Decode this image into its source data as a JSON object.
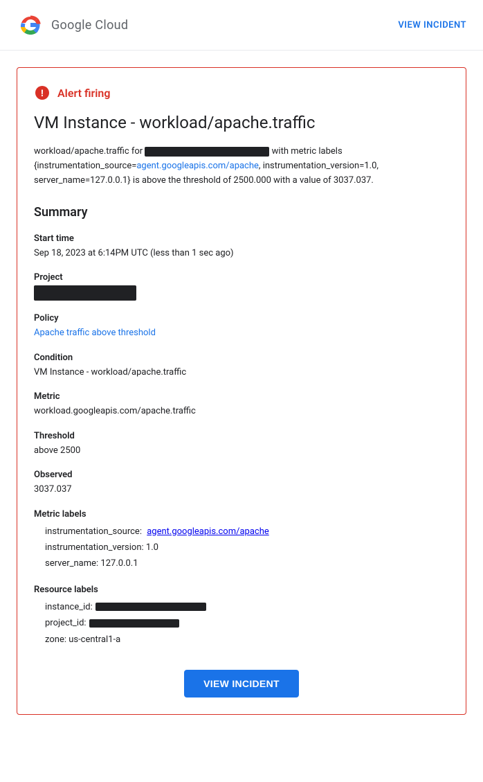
{
  "header": {
    "logo_text": "Google Cloud",
    "view_incident_label": "VIEW INCIDENT"
  },
  "alert": {
    "firing_label": "Alert firing",
    "title": "VM Instance - workload/apache.traffic",
    "description_prefix": "workload/apache.traffic for",
    "description_middle": "with metric labels {instrumentation_source=",
    "description_link_text": "agent.googleapis.com/apache",
    "description_link_href": "agent.googleapis.com/apache",
    "description_suffix": ", instrumentation_version=1.0, server_name=127.0.0.1} is above the threshold of 2500.000 with a value of 3037.037.",
    "summary_title": "Summary",
    "fields": {
      "start_time_label": "Start time",
      "start_time_value": "Sep 18, 2023 at 6:14PM UTC (less than 1 sec ago)",
      "project_label": "Project",
      "policy_label": "Policy",
      "policy_link_text": "Apache traffic above threshold",
      "policy_link_href": "#",
      "condition_label": "Condition",
      "condition_value": "VM Instance - workload/apache.traffic",
      "metric_label": "Metric",
      "metric_value": "workload.googleapis.com/apache.traffic",
      "threshold_label": "Threshold",
      "threshold_value": "above 2500",
      "observed_label": "Observed",
      "observed_value": "3037.037"
    },
    "metric_labels": {
      "title": "Metric labels",
      "instrumentation_source_label": "instrumentation_source:",
      "instrumentation_source_link": "agent.googleapis.com/apache",
      "instrumentation_version": "instrumentation_version: 1.0",
      "server_name": "server_name: 127.0.0.1"
    },
    "resource_labels": {
      "title": "Resource labels",
      "instance_id_label": "instance_id:",
      "project_id_label": "project_id:",
      "zone": "zone: us-central1-a"
    }
  },
  "footer": {
    "view_incident_button": "VIEW INCIDENT"
  }
}
